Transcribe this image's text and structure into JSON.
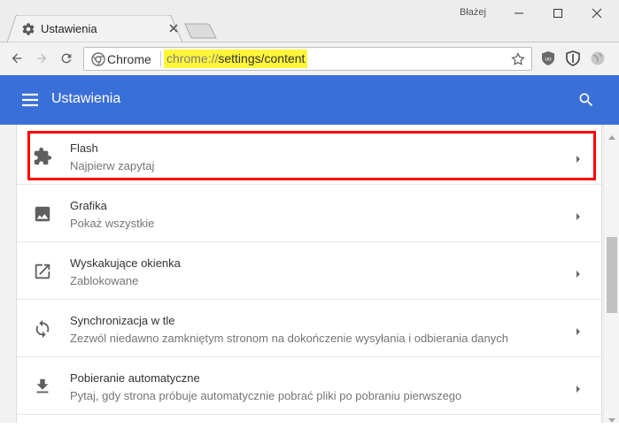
{
  "window": {
    "user_name": "Błażej",
    "controls": {
      "minimize": "minimize-icon",
      "maximize": "maximize-icon",
      "close": "close-icon"
    }
  },
  "tab": {
    "title": "Ustawienia",
    "icon": "gear-icon"
  },
  "toolbar": {
    "site_label": "Chrome",
    "url_scheme": "chrome://",
    "url_path": "settings/content",
    "extensions": [
      "ublock-icon",
      "shield-icon",
      "globe-icon"
    ]
  },
  "appbar": {
    "title": "Ustawienia",
    "menu_icon": "menu-icon",
    "search_icon": "search-icon"
  },
  "settings_rows": [
    {
      "title": "Flash",
      "subtitle": "Najpierw zapytaj",
      "icon": "puzzle-icon",
      "highlighted": true
    },
    {
      "title": "Grafika",
      "subtitle": "Pokaż wszystkie",
      "icon": "image-icon",
      "highlighted": false
    },
    {
      "title": "Wyskakujące okienka",
      "subtitle": "Zablokowane",
      "icon": "open-in-new-icon",
      "highlighted": false
    },
    {
      "title": "Synchronizacja w tle",
      "subtitle": "Zezwól niedawno zamkniętym stronom na dokończenie wysyłania i odbierania danych",
      "icon": "sync-icon",
      "highlighted": false
    },
    {
      "title": "Pobieranie automatyczne",
      "subtitle": "Pytaj, gdy strona próbuje automatycznie pobrać pliki po pobraniu pierwszego",
      "icon": "download-icon",
      "highlighted": false
    }
  ],
  "colors": {
    "appbar": "#3b6fd8",
    "highlight_box": "#ff0000",
    "url_highlight": "#fff63a"
  }
}
